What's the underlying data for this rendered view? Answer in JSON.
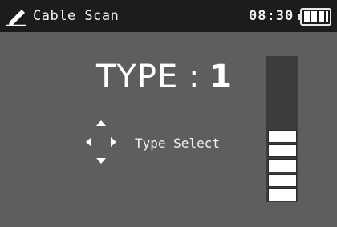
{
  "header": {
    "icon": "pencil-icon",
    "title": "Cable Scan",
    "time": "08:30",
    "battery_icon": "battery-icon"
  },
  "main": {
    "type_label": "TYPE",
    "type_separator": ":",
    "type_value": "1",
    "dpad_icon": "dpad-icon",
    "hint_label": "Type Select"
  },
  "level_indicator": {
    "total_segments": 10,
    "filled_segments": 5
  },
  "colors": {
    "background": "#5e5e5e",
    "titlebar": "#1c1c1c",
    "text": "#ffffff",
    "level_track": "#3c3c3c",
    "level_fill": "#ffffff"
  }
}
